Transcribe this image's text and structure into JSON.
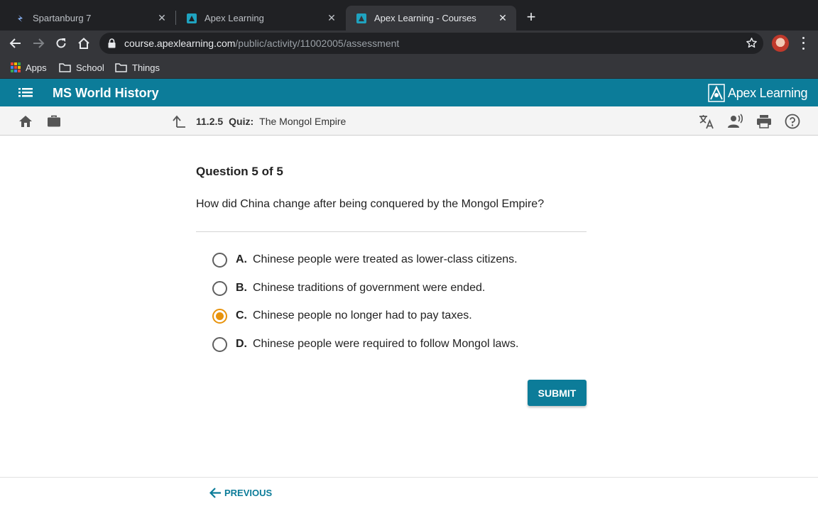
{
  "browser": {
    "tabs": [
      {
        "title": "Spartanburg 7",
        "close": "✕"
      },
      {
        "title": "Apex Learning",
        "close": "✕"
      },
      {
        "title": "Apex Learning - Courses",
        "close": "✕"
      }
    ],
    "new_tab": "+",
    "url": {
      "host": "course.apexlearning.com",
      "path": "/public/activity/11002005/assessment"
    },
    "bookmarks": [
      "Apps",
      "School",
      "Things"
    ]
  },
  "app": {
    "course_title": "MS World History",
    "brand": "Apex Learning",
    "colors": {
      "primary": "#0c7c99",
      "selected": "#e8930c"
    }
  },
  "breadcrumb": {
    "number": "11.2.5",
    "kind": "Quiz:",
    "name": "The Mongol Empire"
  },
  "question": {
    "heading": "Question 5 of 5",
    "prompt": "How did China change after being conquered by the Mongol Empire?",
    "choices": [
      {
        "letter": "A.",
        "text": "Chinese people were treated as lower-class citizens.",
        "selected": false
      },
      {
        "letter": "B.",
        "text": "Chinese traditions of government were ended.",
        "selected": false
      },
      {
        "letter": "C.",
        "text": "Chinese people no longer had to pay taxes.",
        "selected": true
      },
      {
        "letter": "D.",
        "text": "Chinese people were required to follow Mongol laws.",
        "selected": false
      }
    ],
    "submit_label": "SUBMIT"
  },
  "footer": {
    "previous_label": "PREVIOUS"
  }
}
